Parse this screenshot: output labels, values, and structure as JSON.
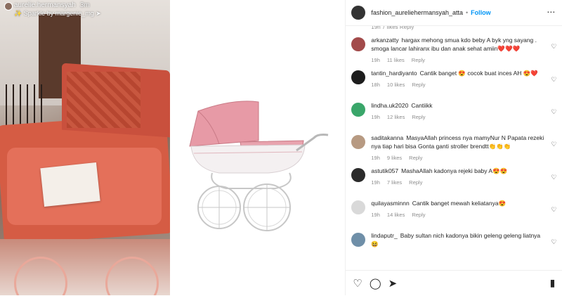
{
  "story": {
    "username": "aurelie.hermansyah",
    "time": "3m",
    "sparkle": "✨ Sparkle by margenie_mg ➤"
  },
  "post": {
    "username": "fashion_aureliehermansyah_atta",
    "dot": "•",
    "follow": "Follow",
    "more_icon": "⋯"
  },
  "partial_meta": "19h    7 likes    Reply",
  "comments": [
    {
      "user": "arkanzatty",
      "text": "hargax mehong smua kdo beby A byk yng sayang . smoga lancar lahiranx ibu dan anak sehat amiin❤️❤️❤️",
      "time": "19h",
      "likes": "11 likes",
      "reply": "Reply",
      "avatar_color": "#a24a4a"
    },
    {
      "user": "tantin_hardiyanto",
      "text": "Cantik banget 😍 cocok buat inces AH 😍❤️",
      "time": "18h",
      "likes": "10 likes",
      "reply": "Reply",
      "avatar_color": "#1d1d1d"
    },
    {
      "user": "lindha.uk2020",
      "text": "Cantiikk",
      "time": "19h",
      "likes": "12 likes",
      "reply": "Reply",
      "avatar_color": "#3aa66a"
    },
    {
      "user": "saditakanna",
      "text": "MasyaAllah princess nya mamyNur N Papata rezeki nya tiap hari bisa Gonta ganti stroller brendtt👏👏👏",
      "time": "19h",
      "likes": "9 likes",
      "reply": "Reply",
      "avatar_color": "#b79a82"
    },
    {
      "user": "astutik057",
      "text": "MashaAllah kadonya rejeki baby A😍😍",
      "time": "19h",
      "likes": "7 likes",
      "reply": "Reply",
      "avatar_color": "#2b2b2b"
    },
    {
      "user": "quilayasminnn",
      "text": "Cantik banget mewah keliatanya😍",
      "time": "19h",
      "likes": "14 likes",
      "reply": "Reply",
      "avatar_color": "#d9d9d9"
    },
    {
      "user": "lindaputr_",
      "text": "Baby sultan nich kadonya bikin geleng geleng liatnya😆",
      "time": "",
      "likes": "",
      "reply": "",
      "avatar_color": "#6f8fa8"
    }
  ],
  "heart_icon": "♡",
  "actions": {
    "like_icon": "♡",
    "comment_icon": "◯",
    "share_icon": "➤",
    "bookmark_icon": "▮"
  }
}
